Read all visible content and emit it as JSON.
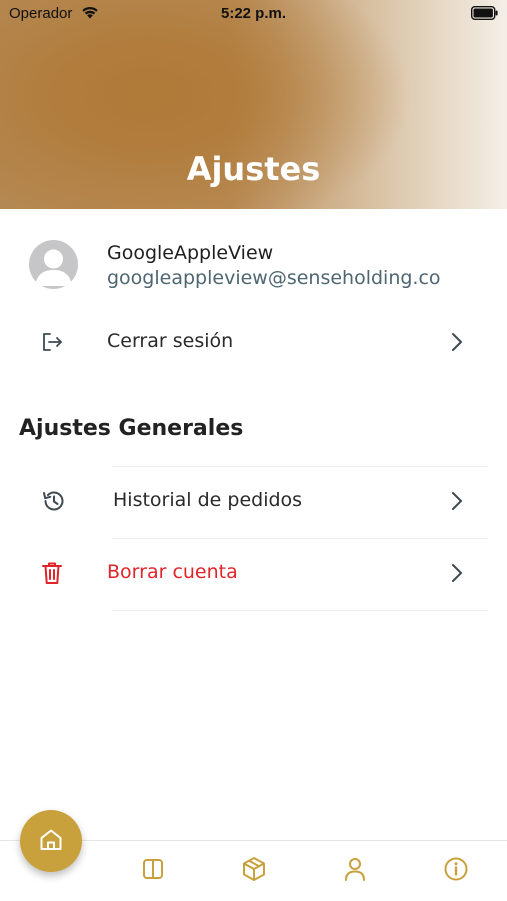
{
  "status_bar": {
    "carrier": "Operador",
    "time": "5:22 p.m."
  },
  "header": {
    "title": "Ajustes"
  },
  "profile": {
    "name": "GoogleAppleView",
    "email": "googleappleview@senseholding.co"
  },
  "logout": {
    "label": "Cerrar sesión"
  },
  "general": {
    "title": "Ajustes Generales",
    "items": [
      {
        "label": "Historial de pedidos",
        "icon": "history-icon"
      },
      {
        "label": "Borrar cuenta",
        "icon": "trash-icon",
        "color": "#e0242a"
      }
    ]
  },
  "tabbar": {
    "accent": "#c9a13c",
    "items": [
      "home-icon",
      "book-icon",
      "package-icon",
      "profile-icon",
      "info-icon"
    ]
  }
}
